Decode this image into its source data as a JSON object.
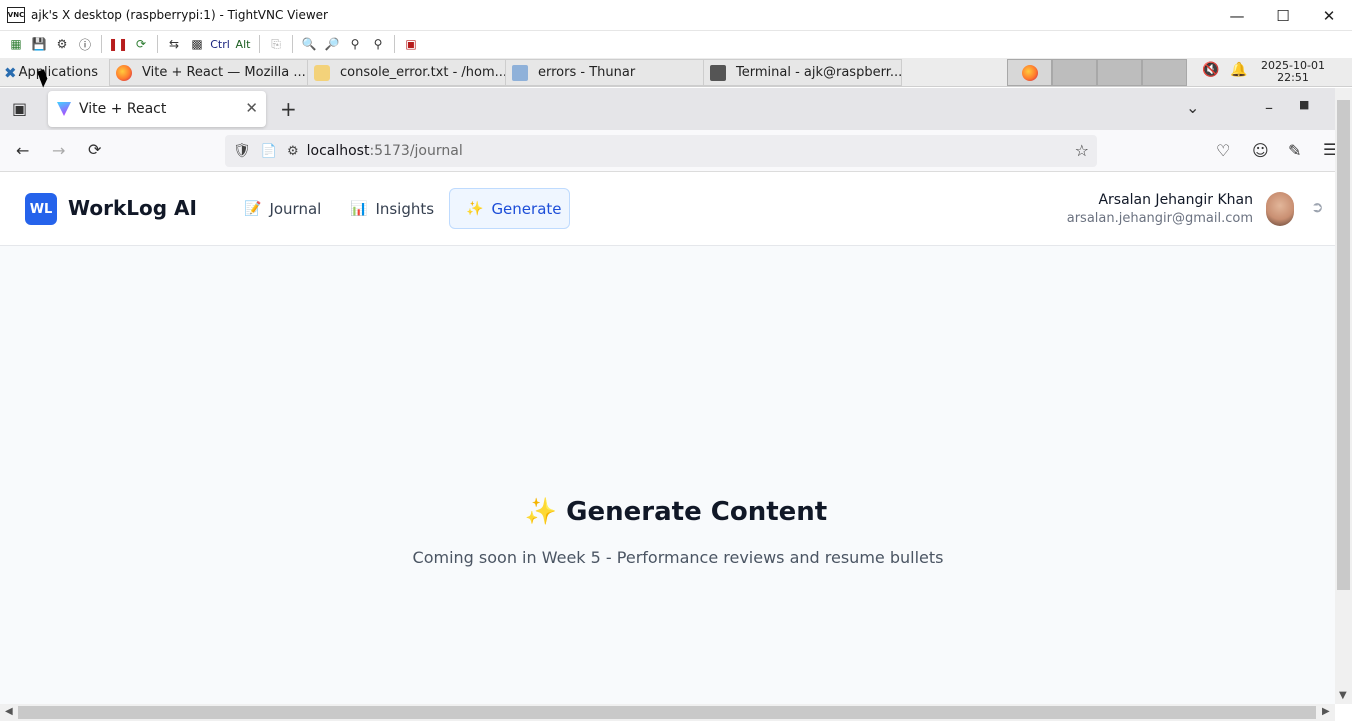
{
  "vnc": {
    "logo": "VNC",
    "title": "ajk's X desktop (raspberrypi:1) - TightVNC Viewer",
    "toolbar": {
      "ctrl_label": "Ctrl",
      "alt_label": "Alt"
    }
  },
  "panel": {
    "applications_label": "Applications",
    "tasks": [
      {
        "label": "Vite + React — Mozilla ...",
        "icon": "firefox-icon"
      },
      {
        "label": "console_error.txt - /hom...",
        "icon": "text-editor-icon"
      },
      {
        "label": "errors - Thunar",
        "icon": "folder-icon"
      },
      {
        "label": "Terminal - ajk@raspberr...",
        "icon": "terminal-icon"
      }
    ],
    "clock_date": "2025-10-01",
    "clock_time": "22:51"
  },
  "browser": {
    "tab_title": "Vite + React",
    "url_host": "localhost",
    "url_path": ":5173/journal"
  },
  "app": {
    "logo_initials": "WL",
    "brand": "WorkLog AI",
    "nav": [
      {
        "icon": "📝",
        "label": "Journal",
        "active": false
      },
      {
        "icon": "📊",
        "label": "Insights",
        "active": false
      },
      {
        "icon": "✨",
        "label": "Generate",
        "active": true
      }
    ],
    "user_name": "Arsalan Jehangir Khan",
    "user_email": "arsalan.jehangir@gmail.com",
    "hero_title": "✨ Generate Content",
    "hero_subtitle": "Coming soon in Week 5 - Performance reviews and resume bullets"
  },
  "colors": {
    "brand_blue": "#2563eb",
    "active_nav_bg": "#eff6ff",
    "page_bg": "#f8fafc"
  }
}
